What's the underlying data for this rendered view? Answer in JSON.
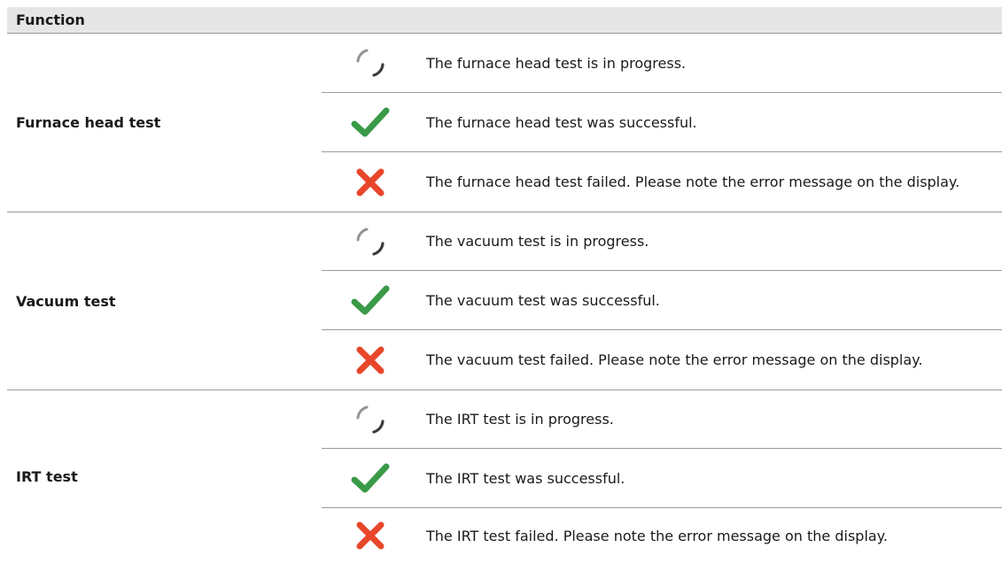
{
  "table": {
    "header": "Function",
    "groups": [
      {
        "function": "Furnace head test",
        "states": [
          {
            "icon": "spinner-icon",
            "text": "The furnace head test is in progress."
          },
          {
            "icon": "checkmark-icon",
            "text": "The furnace head test was successful."
          },
          {
            "icon": "cross-icon",
            "text": "The furnace head test failed. Please note the error message on the display."
          }
        ]
      },
      {
        "function": "Vacuum test",
        "states": [
          {
            "icon": "spinner-icon",
            "text": "The vacuum test is in progress."
          },
          {
            "icon": "checkmark-icon",
            "text": "The vacuum test was successful."
          },
          {
            "icon": "cross-icon",
            "text": "The vacuum test failed. Please note the error message on the display."
          }
        ]
      },
      {
        "function": "IRT test",
        "states": [
          {
            "icon": "spinner-icon",
            "text": "The IRT test is in progress."
          },
          {
            "icon": "checkmark-icon",
            "text": "The IRT test was successful."
          },
          {
            "icon": "cross-icon",
            "text": "The IRT test failed. Please note the error message on the display."
          }
        ]
      }
    ]
  },
  "colors": {
    "header_bg": "#e6e6e6",
    "success": "#3a9a48",
    "failure": "#e8462a",
    "spinner": "#3c3c3c",
    "rule": "#9a9a9a"
  }
}
